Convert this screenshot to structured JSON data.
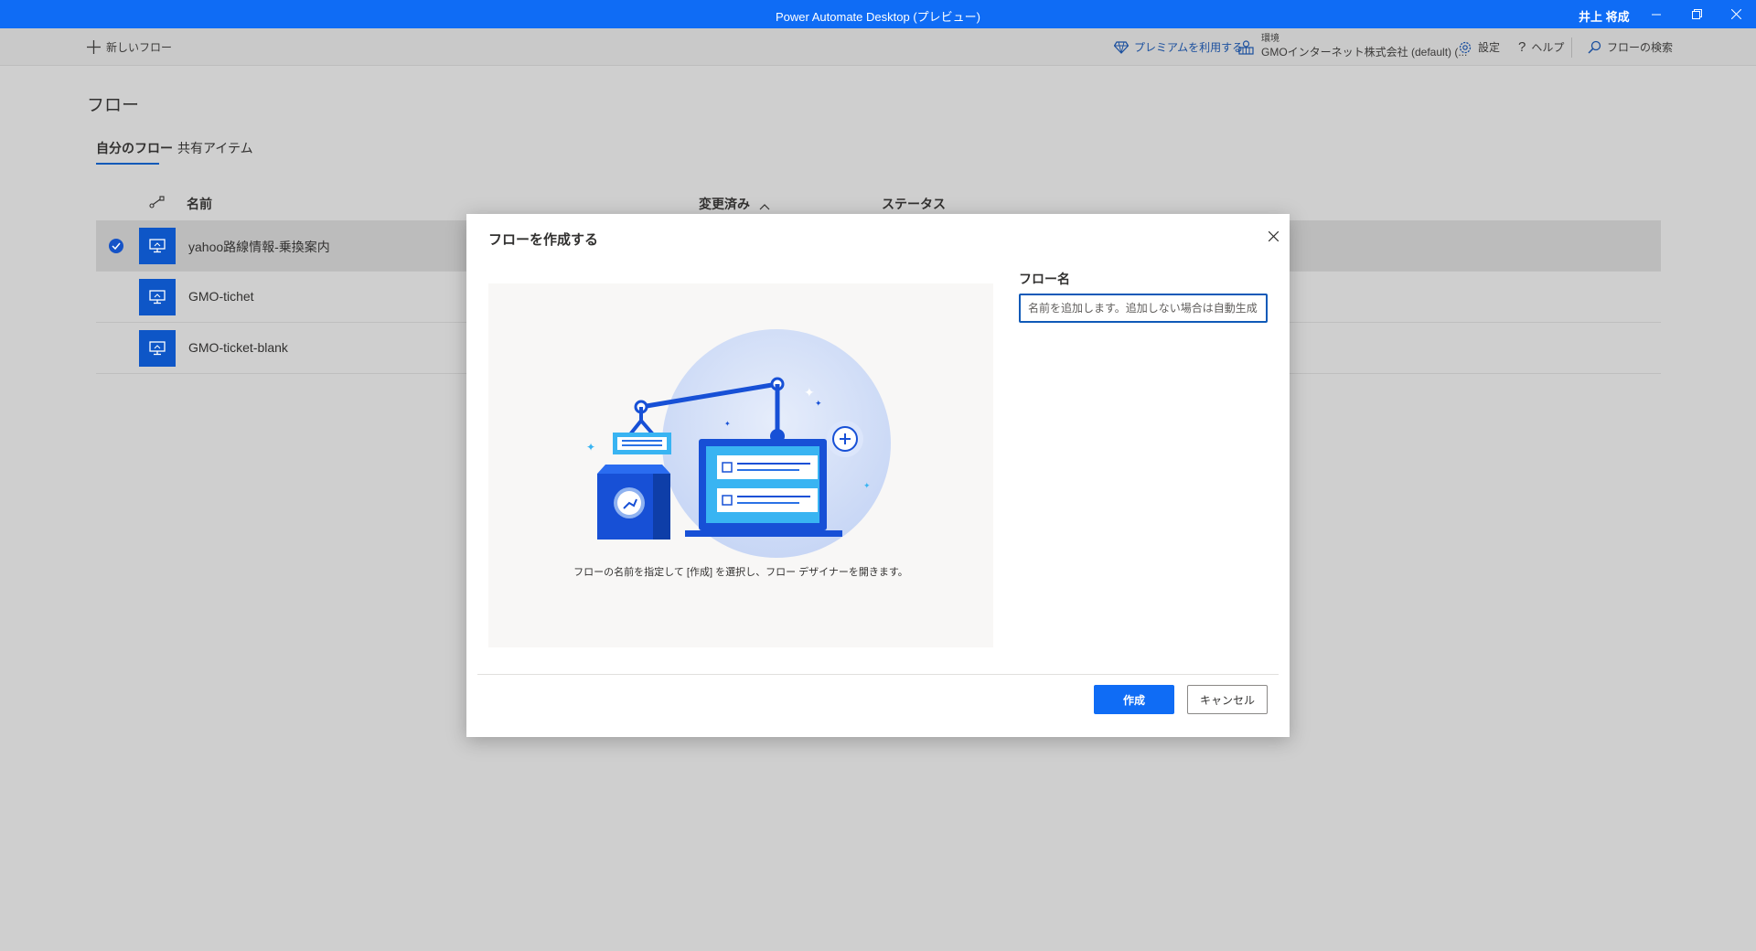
{
  "window": {
    "title": "Power Automate Desktop (プレビュー)",
    "user": "井上 将成"
  },
  "toolbar": {
    "new_flow": "新しいフロー",
    "premium": "プレミアムを利用する",
    "env_label": "環境",
    "env_value": "GMOインターネット株式会社 (default) (...",
    "settings": "設定",
    "help": "ヘルプ",
    "search": "フローの検索"
  },
  "page": {
    "title": "フロー",
    "tabs": [
      "自分のフロー",
      "共有アイテム"
    ]
  },
  "table": {
    "columns": {
      "name": "名前",
      "modified": "変更済み",
      "status": "ステータス"
    },
    "rows": [
      {
        "name": "yahoo路線情報-乗換案内",
        "selected": true
      },
      {
        "name": "GMO-tichet",
        "selected": false
      },
      {
        "name": "GMO-ticket-blank",
        "selected": false
      }
    ]
  },
  "dialog": {
    "title": "フローを作成する",
    "caption": "フローの名前を指定して [作成] を選択し、フロー デザイナーを開きます。",
    "field_label": "フロー名",
    "field_placeholder": "名前を追加します。追加しない場合は自動生成されます",
    "create": "作成",
    "cancel": "キャンセル"
  },
  "colors": {
    "accent": "#0f6cf5",
    "flow_icon": "#0e56c7"
  }
}
